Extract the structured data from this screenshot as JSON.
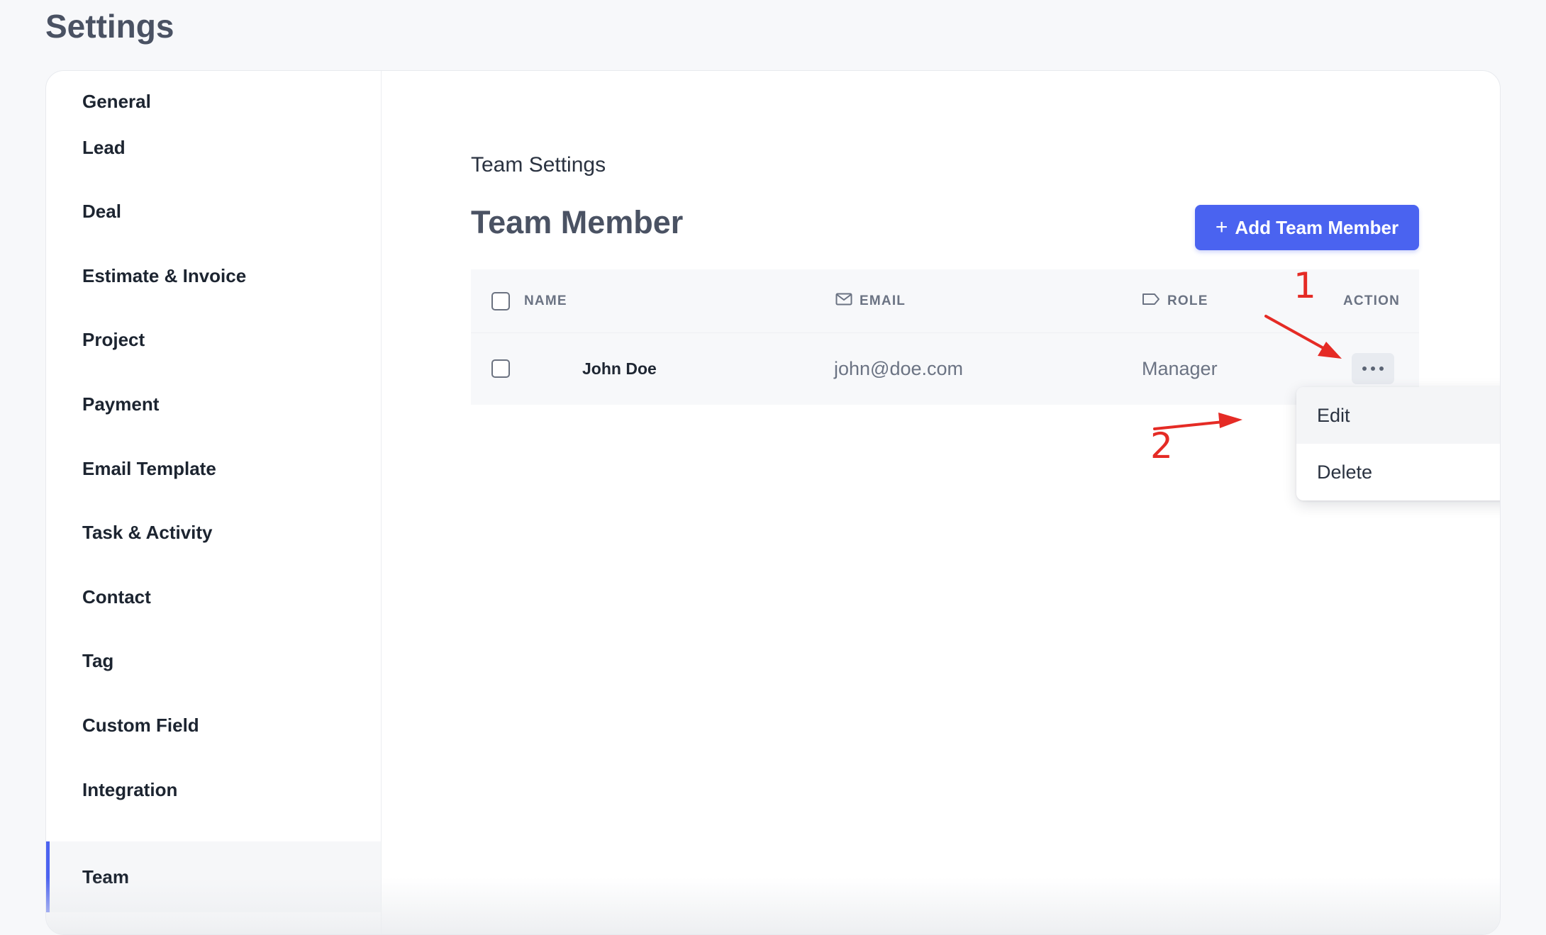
{
  "page": {
    "title": "Settings"
  },
  "sidebar": {
    "items": [
      {
        "label": "General",
        "active": false
      },
      {
        "label": "Lead",
        "active": false
      },
      {
        "label": "Deal",
        "active": false
      },
      {
        "label": "Estimate & Invoice",
        "active": false
      },
      {
        "label": "Project",
        "active": false
      },
      {
        "label": "Payment",
        "active": false
      },
      {
        "label": "Email Template",
        "active": false
      },
      {
        "label": "Task & Activity",
        "active": false
      },
      {
        "label": "Contact",
        "active": false
      },
      {
        "label": "Tag",
        "active": false
      },
      {
        "label": "Custom Field",
        "active": false
      },
      {
        "label": "Integration",
        "active": false
      },
      {
        "label": "Team",
        "active": true
      }
    ],
    "accent_color": "#4c63f0"
  },
  "main": {
    "section_label": "Team Settings",
    "section_title": "Team Member",
    "add_button": {
      "icon": "plus-icon",
      "label": "Add Team Member",
      "color": "#4a63f0"
    }
  },
  "table": {
    "columns": [
      {
        "key": "name",
        "label": "NAME",
        "icon": ""
      },
      {
        "key": "email",
        "label": "EMAIL",
        "icon": "mail-icon"
      },
      {
        "key": "role",
        "label": "ROLE",
        "icon": "tag-icon"
      },
      {
        "key": "action",
        "label": "ACTION",
        "icon": ""
      }
    ],
    "rows": [
      {
        "name": "John Doe",
        "email": "john@doe.com",
        "role": "Manager"
      }
    ]
  },
  "action_menu": {
    "trigger_icon": "more-horizontal-icon",
    "items": [
      {
        "label": "Edit"
      },
      {
        "label": "Delete"
      }
    ]
  },
  "annotations": {
    "marker_1": "1",
    "marker_2": "2",
    "color": "#e52b25"
  }
}
